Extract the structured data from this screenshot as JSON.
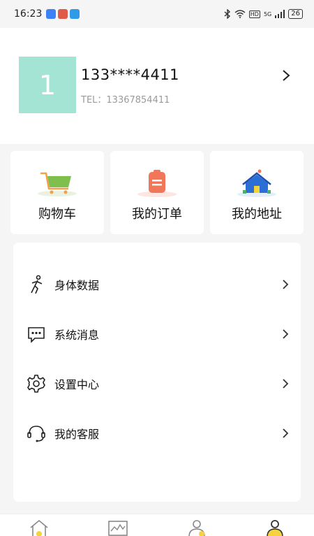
{
  "status_bar": {
    "time": "16:23",
    "network": "HD",
    "signal": "5G",
    "battery": "26"
  },
  "profile": {
    "avatar_text": "1",
    "phone_masked": "133****4411",
    "tel_line": "TEL：13367854411"
  },
  "quick_actions": [
    {
      "label": "购物车",
      "icon": "shopping-cart-icon"
    },
    {
      "label": "我的订单",
      "icon": "order-clipboard-icon"
    },
    {
      "label": "我的地址",
      "icon": "address-house-icon"
    }
  ],
  "menu": [
    {
      "label": "身体数据",
      "icon": "body-figure-icon"
    },
    {
      "label": "系统消息",
      "icon": "message-bubble-icon"
    },
    {
      "label": "设置中心",
      "icon": "gear-icon"
    },
    {
      "label": "我的客服",
      "icon": "headset-icon"
    }
  ],
  "bottom_nav": [
    {
      "icon": "home-icon"
    },
    {
      "icon": "chart-icon"
    },
    {
      "icon": "person-outline-icon"
    },
    {
      "icon": "profile-active-icon"
    }
  ],
  "colors": {
    "avatar_bg": "#a3e4d4",
    "accent_yellow": "#f5d33d",
    "page_bg": "#f5f5f5"
  }
}
